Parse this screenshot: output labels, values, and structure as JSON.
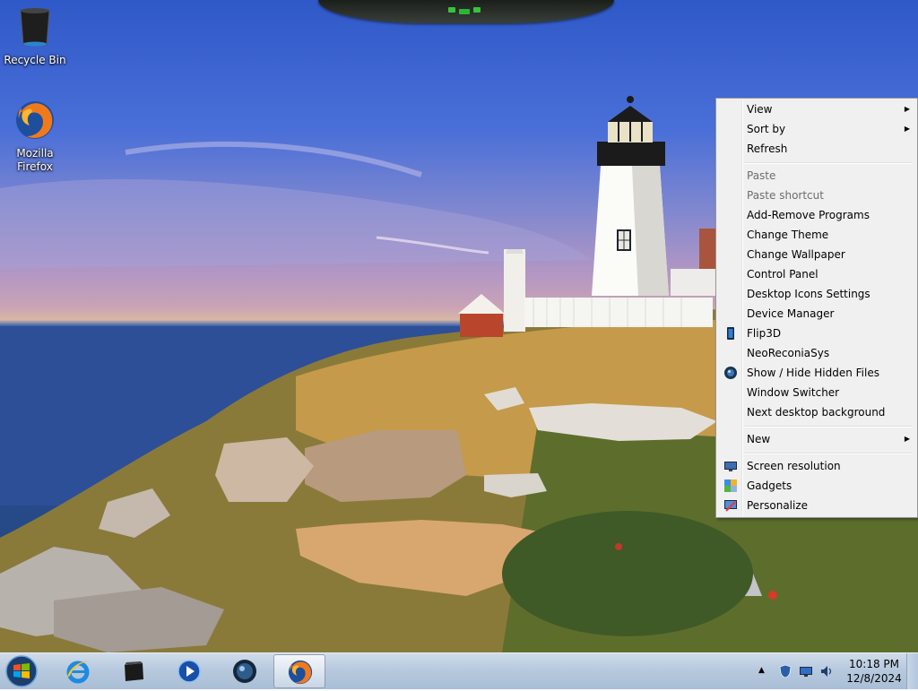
{
  "desktop": {
    "icons": [
      {
        "label": "Recycle Bin",
        "icon": "recycle-bin-icon"
      },
      {
        "label": "Mozilla Firefox",
        "icon": "firefox-icon"
      }
    ],
    "wallpaper": "lighthouse-on-rocky-coast"
  },
  "context_menu": {
    "items": {
      "view": "View",
      "sort_by": "Sort by",
      "refresh": "Refresh",
      "paste": "Paste",
      "paste_shortcut": "Paste shortcut",
      "add_remove": "Add-Remove Programs",
      "change_theme": "Change Theme",
      "change_wallpaper": "Change Wallpaper",
      "control_panel": "Control Panel",
      "desktop_icons": "Desktop Icons Settings",
      "device_manager": "Device Manager",
      "flip3d": "Flip3D",
      "neoreconia": "NeoReconiaSys",
      "show_hide": "Show / Hide Hidden Files",
      "window_switcher": "Window Switcher",
      "next_bg": "Next desktop background",
      "new": "New",
      "screen_res": "Screen resolution",
      "gadgets": "Gadgets",
      "personalize": "Personalize"
    },
    "submenu_arrow": "▶"
  },
  "taskbar": {
    "pinned": [
      {
        "name": "start-orb",
        "icon": "windows-logo-icon"
      },
      {
        "name": "internet-explorer",
        "icon": "ie-icon"
      },
      {
        "name": "app-dark",
        "icon": "dark-box-icon"
      },
      {
        "name": "media-player",
        "icon": "media-player-icon"
      },
      {
        "name": "globe-app",
        "icon": "globe-icon"
      },
      {
        "name": "firefox",
        "icon": "firefox-icon",
        "active": true
      }
    ],
    "tray": {
      "time": "10:18 PM",
      "date": "12/8/2024",
      "overflow_glyph": "▲"
    }
  },
  "colors": {
    "menu_bg": "#f0f0f0",
    "taskbar": "#b5c8dd",
    "sky": "#3a63cc",
    "sea": "#2b4f92"
  }
}
